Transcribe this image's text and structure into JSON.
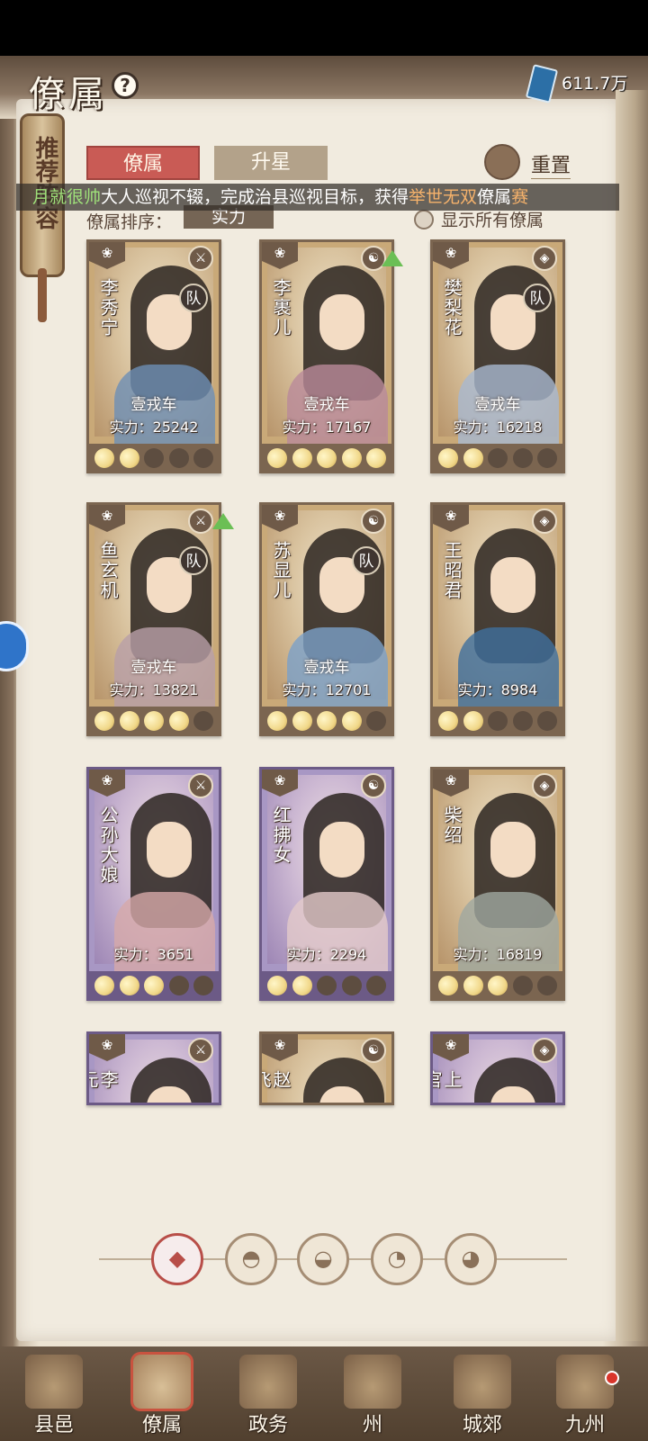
{
  "header": {
    "title": "僚属",
    "currency_amount": "611.7万"
  },
  "recommend_tab": "推荐阵容",
  "tabs": [
    {
      "label": "僚属",
      "active": true
    },
    {
      "label": "升星",
      "active": false
    }
  ],
  "reset_label": "重置",
  "marquee": {
    "player": "月就很帅",
    "text1": "大人巡视不辍，完成治县巡视目标，获得",
    "highlight": "举世无双",
    "text2": "僚属",
    "tail": "赛"
  },
  "sort": {
    "label": "僚属排序：",
    "value": "实力"
  },
  "show_all_label": "显示所有僚属",
  "cards": [
    {
      "name": "李秀宁",
      "rank": "壹戎车",
      "power": "实力：25242",
      "team": "队",
      "stars": 2,
      "theme": "gold"
    },
    {
      "name": "李裹儿",
      "rank": "壹戎车",
      "power": "实力：17167",
      "team": "",
      "stars": 5,
      "theme": "gold",
      "upgrade": true
    },
    {
      "name": "樊梨花",
      "rank": "壹戎车",
      "power": "实力：16218",
      "team": "队",
      "stars": 2,
      "theme": "gold"
    },
    {
      "name": "鱼玄机",
      "rank": "壹戎车",
      "power": "实力：13821",
      "team": "队",
      "stars": 4,
      "theme": "gold",
      "upgrade": true
    },
    {
      "name": "苏显儿",
      "rank": "壹戎车",
      "power": "实力：12701",
      "team": "队",
      "stars": 4,
      "theme": "gold"
    },
    {
      "name": "王昭君",
      "rank": "",
      "power": "实力：8984",
      "team": "",
      "stars": 2,
      "theme": "gold"
    },
    {
      "name": "公孙大娘",
      "rank": "",
      "power": "实力：3651",
      "team": "",
      "stars": 3,
      "theme": "purple"
    },
    {
      "name": "红拂女",
      "rank": "",
      "power": "实力：2294",
      "team": "",
      "stars": 2,
      "theme": "purple"
    },
    {
      "name": "柴绍",
      "rank": "",
      "power": "实力：16819",
      "team": "",
      "stars": 3,
      "theme": "gold"
    },
    {
      "name": "李元霸",
      "rank": "",
      "power": "",
      "team": "",
      "stars": 0,
      "theme": "purple"
    },
    {
      "name": "赵飞燕",
      "rank": "",
      "power": "",
      "team": "",
      "stars": 0,
      "theme": "gold"
    },
    {
      "name": "上官婉儿",
      "rank": "",
      "power": "",
      "team": "",
      "stars": 0,
      "theme": "purple"
    }
  ],
  "filters": [
    "all-filter-icon",
    "bell-filter-icon",
    "gourd-filter-icon",
    "fan-filter-icon",
    "lion-filter-icon"
  ],
  "bottom_nav": [
    {
      "label": "县邑",
      "active": false
    },
    {
      "label": "僚属",
      "active": true
    },
    {
      "label": "政务",
      "active": false
    },
    {
      "label": "州",
      "active": false
    },
    {
      "label": "城郊",
      "active": false
    },
    {
      "label": "九州",
      "active": false
    }
  ]
}
